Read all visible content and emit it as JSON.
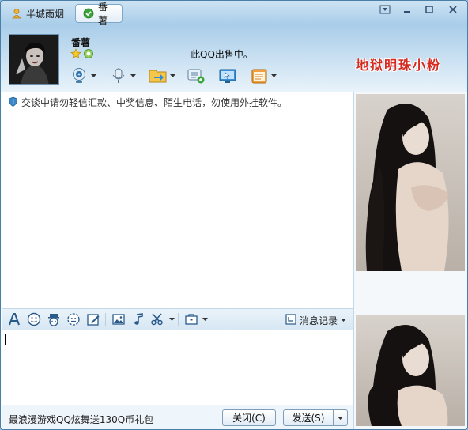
{
  "tabs": [
    {
      "label": "半城雨烟",
      "icon": "user-icon",
      "active": false
    },
    {
      "label": "番薯",
      "icon": "check-icon",
      "active": true
    }
  ],
  "contact": {
    "name": "番薯",
    "status_message": "此QQ出售中。"
  },
  "banner": {
    "text": "地狱明珠小粉"
  },
  "notice": {
    "text": "交谈中请勿轻信汇款、中奖信息、陌生电话，勿使用外挂软件。"
  },
  "toolbar": {
    "items": [
      "webcam-icon",
      "microphone-icon",
      "send-file-icon",
      "sms-icon",
      "remote-assist-icon",
      "apps-icon"
    ]
  },
  "format_bar": {
    "history_label": "消息记录"
  },
  "bottom": {
    "ad_text": "最浪漫游戏QQ炫舞送130Q币礼包",
    "close_label": "关闭(C)",
    "send_label": "发送(S)"
  },
  "colors": {
    "accent_blue": "#4a7fa8",
    "banner_red": "#d42a1f"
  }
}
